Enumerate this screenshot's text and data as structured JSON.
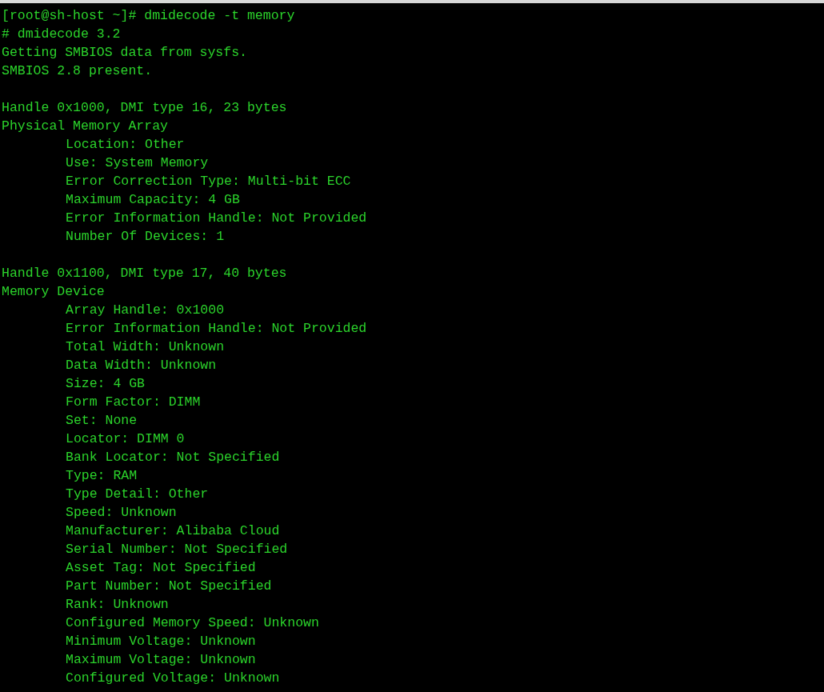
{
  "terminal": {
    "command_line": "[root@sh-host ~]# dmidecode -t memory",
    "preamble": [
      "# dmidecode 3.2",
      "Getting SMBIOS data from sysfs.",
      "SMBIOS 2.8 present."
    ],
    "sections": [
      {
        "handle": "Handle 0x1000, DMI type 16, 23 bytes",
        "title": "Physical Memory Array",
        "fields": [
          "Location: Other",
          "Use: System Memory",
          "Error Correction Type: Multi-bit ECC",
          "Maximum Capacity: 4 GB",
          "Error Information Handle: Not Provided",
          "Number Of Devices: 1"
        ]
      },
      {
        "handle": "Handle 0x1100, DMI type 17, 40 bytes",
        "title": "Memory Device",
        "fields": [
          "Array Handle: 0x1000",
          "Error Information Handle: Not Provided",
          "Total Width: Unknown",
          "Data Width: Unknown",
          "Size: 4 GB",
          "Form Factor: DIMM",
          "Set: None",
          "Locator: DIMM 0",
          "Bank Locator: Not Specified",
          "Type: RAM",
          "Type Detail: Other",
          "Speed: Unknown",
          "Manufacturer: Alibaba Cloud",
          "Serial Number: Not Specified",
          "Asset Tag: Not Specified",
          "Part Number: Not Specified",
          "Rank: Unknown",
          "Configured Memory Speed: Unknown",
          "Minimum Voltage: Unknown",
          "Maximum Voltage: Unknown",
          "Configured Voltage: Unknown"
        ]
      }
    ]
  }
}
